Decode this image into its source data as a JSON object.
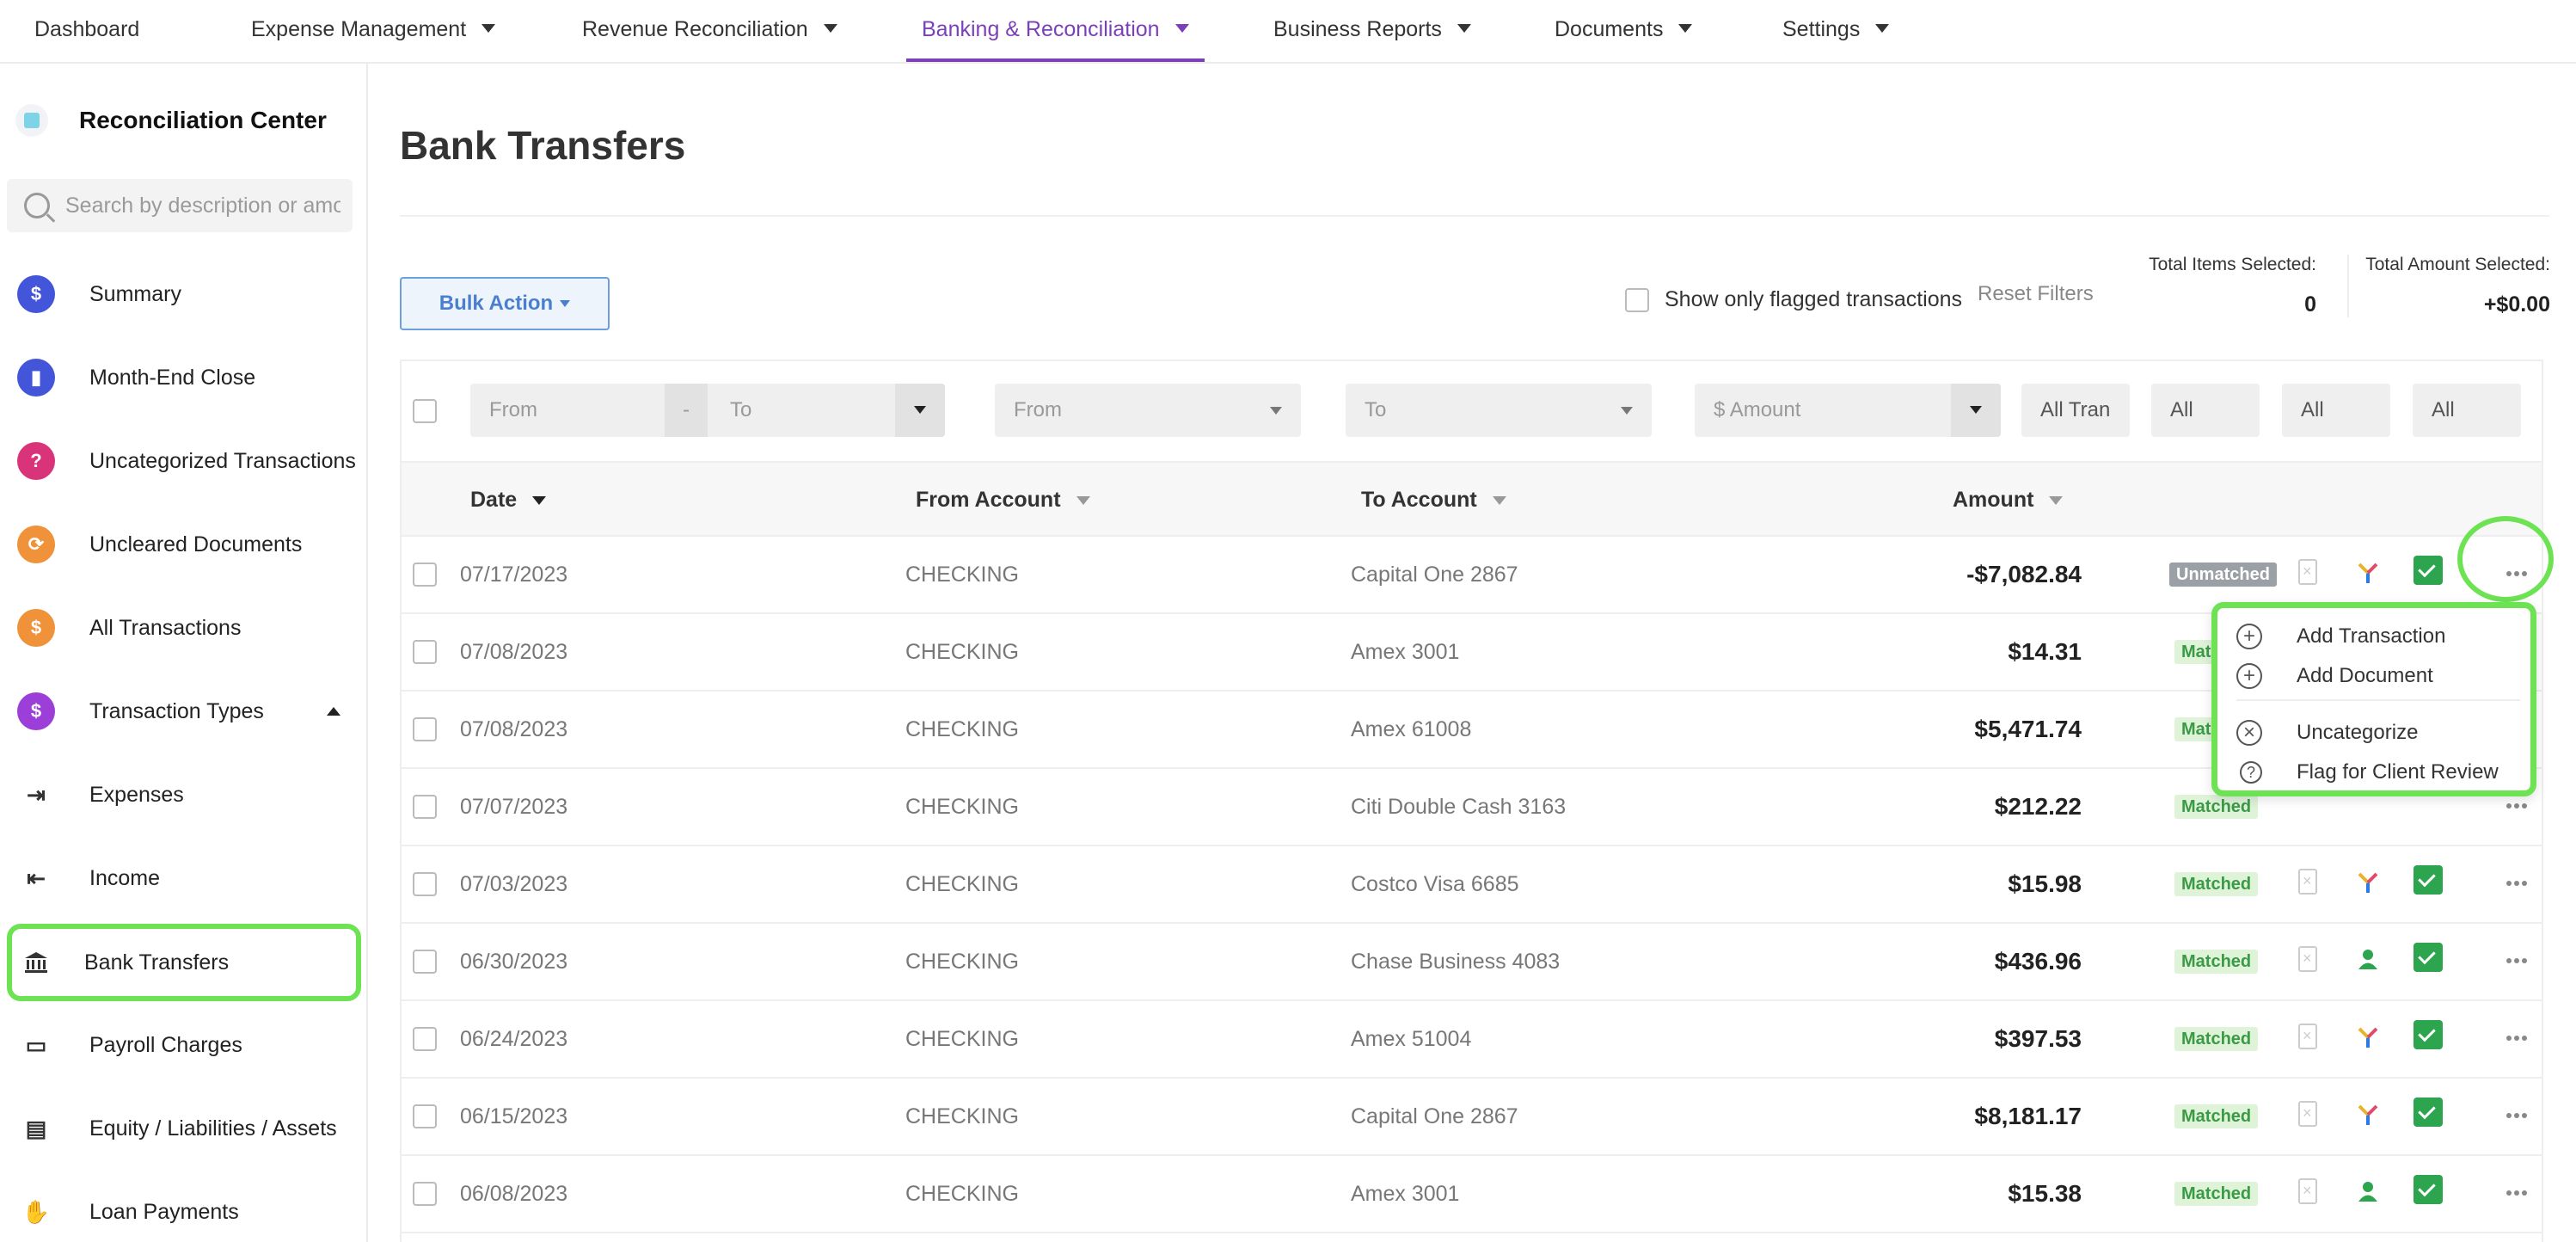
{
  "nav": {
    "items": [
      {
        "label": "Dashboard",
        "caret": false,
        "active": false
      },
      {
        "label": "Expense Management",
        "caret": true,
        "active": false
      },
      {
        "label": "Revenue Reconciliation",
        "caret": true,
        "active": false
      },
      {
        "label": "Banking & Reconciliation",
        "caret": true,
        "active": true
      },
      {
        "label": "Business Reports",
        "caret": true,
        "active": false
      },
      {
        "label": "Documents",
        "caret": true,
        "active": false
      },
      {
        "label": "Settings",
        "caret": true,
        "active": false
      }
    ],
    "active_color": "#7b3fb8"
  },
  "sidebar": {
    "title": "Reconciliation Center",
    "search_placeholder": "Search by description or amount",
    "items": [
      {
        "label": "Summary",
        "icon": "clipboard-icon",
        "icon_glyph": "$",
        "color": "#4355d8"
      },
      {
        "label": "Month-End Close",
        "icon": "chart-icon",
        "icon_glyph": "▮",
        "color": "#4355d8"
      },
      {
        "label": "Uncategorized Transactions",
        "icon": "question-icon",
        "icon_glyph": "?",
        "color": "#d9347a"
      },
      {
        "label": "Uncleared Documents",
        "icon": "refresh-icon",
        "icon_glyph": "⟳",
        "color": "#f0923a"
      },
      {
        "label": "All Transactions",
        "icon": "transfer-icon",
        "icon_glyph": "$",
        "color": "#f0923a"
      },
      {
        "label": "Transaction Types",
        "icon": "types-icon",
        "icon_glyph": "$",
        "color": "#9b3fd8"
      },
      {
        "label": "Expenses",
        "icon": "expense-icon",
        "icon_glyph": "⇥",
        "color": ""
      },
      {
        "label": "Income",
        "icon": "income-icon",
        "icon_glyph": "⇤",
        "color": ""
      },
      {
        "label": "Bank Transfers",
        "icon": "bank-icon",
        "icon_glyph": "🏛",
        "color": ""
      },
      {
        "label": "Payroll Charges",
        "icon": "payroll-icon",
        "icon_glyph": "▭",
        "color": ""
      },
      {
        "label": "Equity / Liabilities / Assets",
        "icon": "equity-icon",
        "icon_glyph": "▤",
        "color": ""
      },
      {
        "label": "Loan Payments",
        "icon": "loan-icon",
        "icon_glyph": "✋",
        "color": ""
      }
    ],
    "highlight_color": "#6de354"
  },
  "page": {
    "title": "Bank Transfers",
    "bulk_action": "Bulk Action",
    "flag_filter_label": "Show only flagged transactions",
    "reset_filters": "Reset Filters",
    "total_items_label": "Total Items Selected:",
    "total_items_value": "0",
    "total_amount_label": "Total Amount Selected:",
    "total_amount_value": "+$0.00"
  },
  "filters": {
    "date_from": "From",
    "date_sep": "-",
    "date_to": "To",
    "from_account": "From",
    "to_account": "To",
    "amount": "$ Amount",
    "type": "All Tran",
    "status1": "All",
    "status2": "All",
    "status3": "All"
  },
  "table": {
    "headers": {
      "date": "Date",
      "from": "From Account",
      "to": "To Account",
      "amount": "Amount"
    },
    "rows": [
      {
        "date": "07/17/2023",
        "from": "CHECKING",
        "to": "Capital One 2867",
        "amount": "-$7,082.84",
        "status": "Unmatched",
        "source": "yelp"
      },
      {
        "date": "07/08/2023",
        "from": "CHECKING",
        "to": "Amex 3001",
        "amount": "$14.31",
        "status": "Matched",
        "source": "yelp"
      },
      {
        "date": "07/08/2023",
        "from": "CHECKING",
        "to": "Amex 61008",
        "amount": "$5,471.74",
        "status": "Matched",
        "source": "yelp"
      },
      {
        "date": "07/07/2023",
        "from": "CHECKING",
        "to": "Citi Double Cash 3163",
        "amount": "$212.22",
        "status": "Matched",
        "source": "yelp"
      },
      {
        "date": "07/03/2023",
        "from": "CHECKING",
        "to": "Costco Visa 6685",
        "amount": "$15.98",
        "status": "Matched",
        "source": "yelp"
      },
      {
        "date": "06/30/2023",
        "from": "CHECKING",
        "to": "Chase Business 4083",
        "amount": "$436.96",
        "status": "Matched",
        "source": "user"
      },
      {
        "date": "06/24/2023",
        "from": "CHECKING",
        "to": "Amex 51004",
        "amount": "$397.53",
        "status": "Matched",
        "source": "yelp"
      },
      {
        "date": "06/15/2023",
        "from": "CHECKING",
        "to": "Capital One 2867",
        "amount": "$8,181.17",
        "status": "Matched",
        "source": "yelp"
      },
      {
        "date": "06/08/2023",
        "from": "CHECKING",
        "to": "Amex 3001",
        "amount": "$15.38",
        "status": "Matched",
        "source": "user"
      }
    ]
  },
  "menu": {
    "items": [
      {
        "label": "Add Transaction",
        "icon": "plus-circle-icon",
        "glyph": "+"
      },
      {
        "label": "Add Document",
        "icon": "plus-circle-icon",
        "glyph": "+"
      },
      {
        "label": "Uncategorize",
        "icon": "x-circle-icon",
        "glyph": "×"
      },
      {
        "label": "Flag for Client Review",
        "icon": "question-circle-icon",
        "glyph": "?"
      }
    ]
  }
}
